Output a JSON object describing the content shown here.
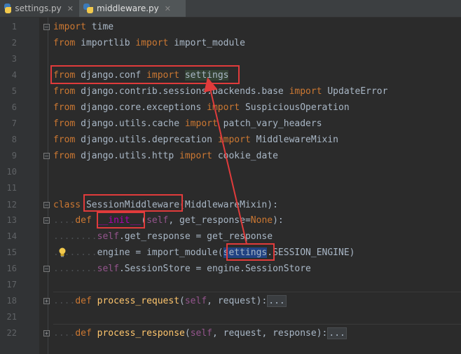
{
  "tabs": [
    {
      "label": "settings.py",
      "active": false
    },
    {
      "label": "middleware.py",
      "active": true
    }
  ],
  "lines": [
    {
      "no": "1",
      "text": "import time"
    },
    {
      "no": "2",
      "text": "from importlib import import_module"
    },
    {
      "no": "3",
      "text": ""
    },
    {
      "no": "4",
      "text": "from django.conf import settings"
    },
    {
      "no": "5",
      "text": "from django.contrib.sessions.backends.base import UpdateError"
    },
    {
      "no": "6",
      "text": "from django.core.exceptions import SuspiciousOperation"
    },
    {
      "no": "7",
      "text": "from django.utils.cache import patch_vary_headers"
    },
    {
      "no": "8",
      "text": "from django.utils.deprecation import MiddlewareMixin"
    },
    {
      "no": "9",
      "text": "from django.utils.http import cookie_date"
    },
    {
      "no": "10",
      "text": ""
    },
    {
      "no": "11",
      "text": ""
    },
    {
      "no": "12",
      "text": "class SessionMiddleware(MiddlewareMixin):"
    },
    {
      "no": "13",
      "text": "    def __init__(self, get_response=None):"
    },
    {
      "no": "14",
      "text": "        self.get_response = get_response"
    },
    {
      "no": "15",
      "text": "        engine = import_module(settings.SESSION_ENGINE)"
    },
    {
      "no": "16",
      "text": "        self.SessionStore = engine.SessionStore"
    },
    {
      "no": "17",
      "text": ""
    },
    {
      "no": "18",
      "text": "    def process_request(self, request):..."
    },
    {
      "no": "21",
      "text": ""
    },
    {
      "no": "22",
      "text": "    def process_response(self, request, response):..."
    }
  ],
  "collapsed_marker": "...",
  "annotation_color": "#e03b3b"
}
